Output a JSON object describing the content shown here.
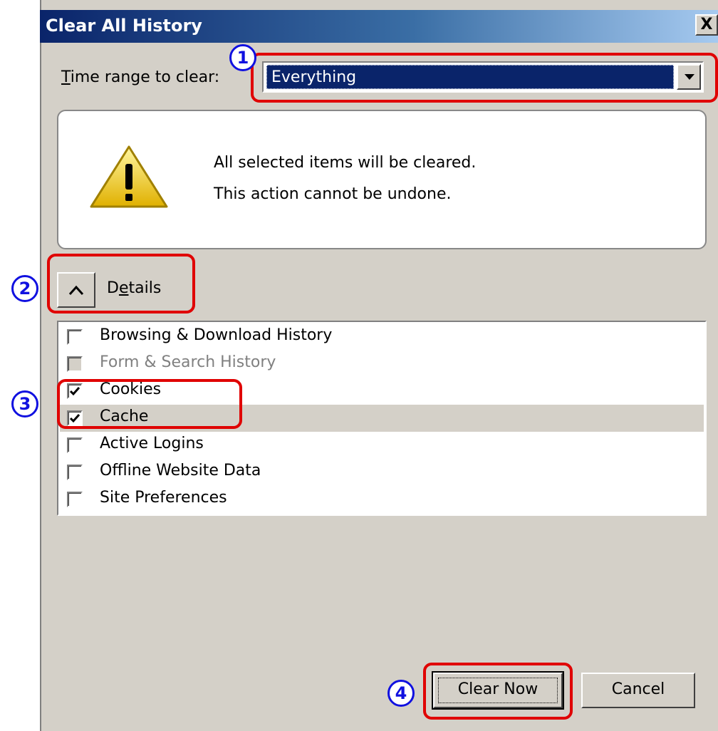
{
  "dialog": {
    "title": "Clear All History",
    "close_label": "X"
  },
  "time_range": {
    "label_underline_char": "T",
    "label_rest": "ime range to clear:",
    "selected": "Everything"
  },
  "warning": {
    "line1": "All selected items will be cleared.",
    "line2": "This action cannot be undone."
  },
  "details": {
    "label_pre": "D",
    "label_underline_char": "e",
    "label_post": "tails"
  },
  "items": [
    {
      "label": "Browsing & Download History",
      "checked": false,
      "disabled": false
    },
    {
      "label": "Form & Search History",
      "checked": false,
      "disabled": true
    },
    {
      "label": "Cookies",
      "checked": true,
      "disabled": false
    },
    {
      "label": "Cache",
      "checked": true,
      "disabled": false
    },
    {
      "label": "Active Logins",
      "checked": false,
      "disabled": false
    },
    {
      "label": "Offline Website Data",
      "checked": false,
      "disabled": false
    },
    {
      "label": "Site Preferences",
      "checked": false,
      "disabled": false
    }
  ],
  "buttons": {
    "clear_now": "Clear Now",
    "cancel": "Cancel"
  },
  "annotations": {
    "n1": "1",
    "n2": "2",
    "n3": "3",
    "n4": "4",
    "highlight_color": "#e00000",
    "number_color": "#1010e0"
  }
}
